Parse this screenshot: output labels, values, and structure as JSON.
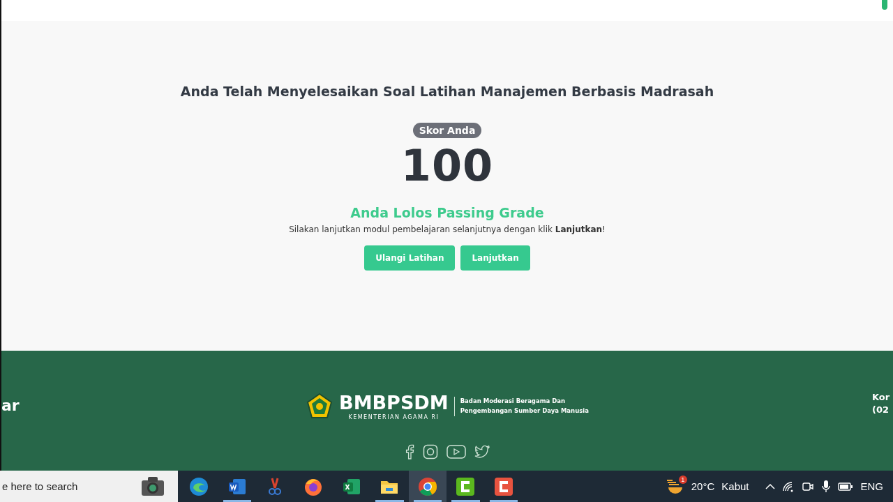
{
  "result": {
    "title": "Anda Telah Menyelesaikan Soal Latihan Manajemen Berbasis Madrasah",
    "score_label": "Skor Anda",
    "score": "100",
    "status": "Anda Lolos Passing Grade",
    "message": "Silakan lanjutkan modul pembelajaran selanjutnya dengan klik **Lanjutkan**!",
    "buttons": [
      "Ulangi Latihan",
      "Lanjutkan"
    ]
  },
  "footer": {
    "left_text": "ar",
    "logo": {
      "name": "BMBPSDM",
      "subtitle": "KEMENTERIAN AGAMA RI",
      "description": [
        "Badan Moderasi Beragama Dan",
        "Pengembangan Sumber Daya Manusia"
      ]
    },
    "right_lines": [
      "Kor",
      "(02"
    ],
    "social": [
      {
        "kind": "facebook"
      },
      {
        "kind": "instagram"
      },
      {
        "kind": "youtube"
      },
      {
        "kind": "twitter"
      }
    ]
  },
  "taskbar": {
    "search": {
      "placeholder": "e here to search"
    },
    "apps": [
      {
        "kind": "edge",
        "running": false,
        "selected": false
      },
      {
        "kind": "word",
        "running": true,
        "selected": false
      },
      {
        "kind": "snip",
        "running": false,
        "selected": false
      },
      {
        "kind": "firefox",
        "running": false,
        "selected": false
      },
      {
        "kind": "excel",
        "running": false,
        "selected": false
      },
      {
        "kind": "explorer",
        "running": true,
        "selected": false
      },
      {
        "kind": "chrome",
        "running": true,
        "selected": true
      },
      {
        "kind": "camtasia-green",
        "running": true,
        "selected": false
      },
      {
        "kind": "camtasia-red",
        "running": true,
        "selected": false
      }
    ],
    "weather": {
      "badge": "1",
      "temperature": "20°C",
      "condition": "Kabut"
    },
    "language": "ENG"
  }
}
